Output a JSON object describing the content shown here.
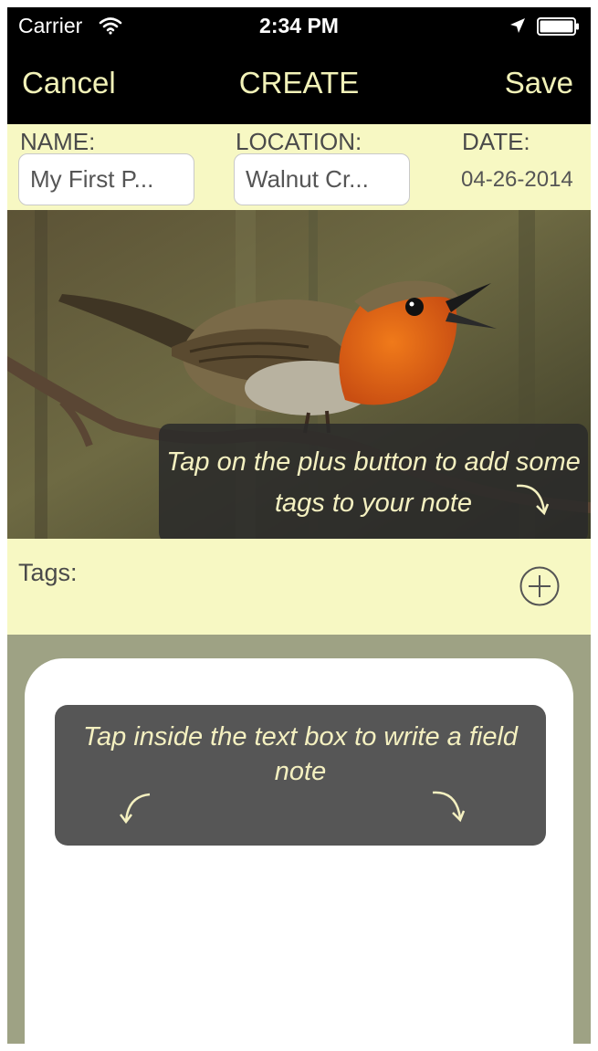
{
  "status_bar": {
    "carrier": "Carrier",
    "time": "2:34 PM"
  },
  "nav": {
    "cancel_label": "Cancel",
    "title": "CREATE",
    "save_label": "Save"
  },
  "meta": {
    "name_label": "NAME:",
    "name_value": "My First P...",
    "location_label": "LOCATION:",
    "location_value": "Walnut Cr...",
    "date_label": "DATE:",
    "date_value": "04-26-2014"
  },
  "photo": {
    "subject_icon": "robin-bird-photo"
  },
  "tips": {
    "tags_tip": "Tap on the plus button to add some tags to your note",
    "note_tip": "Tap inside the text box to write a field note"
  },
  "tags": {
    "label": "Tags:",
    "add_icon": "plus-circle-icon"
  },
  "colors": {
    "nav_text": "#f2f2b8",
    "panel_bg": "#f7f8c3",
    "note_area_bg": "#9ea284",
    "tip_text": "#f4f0c0"
  }
}
